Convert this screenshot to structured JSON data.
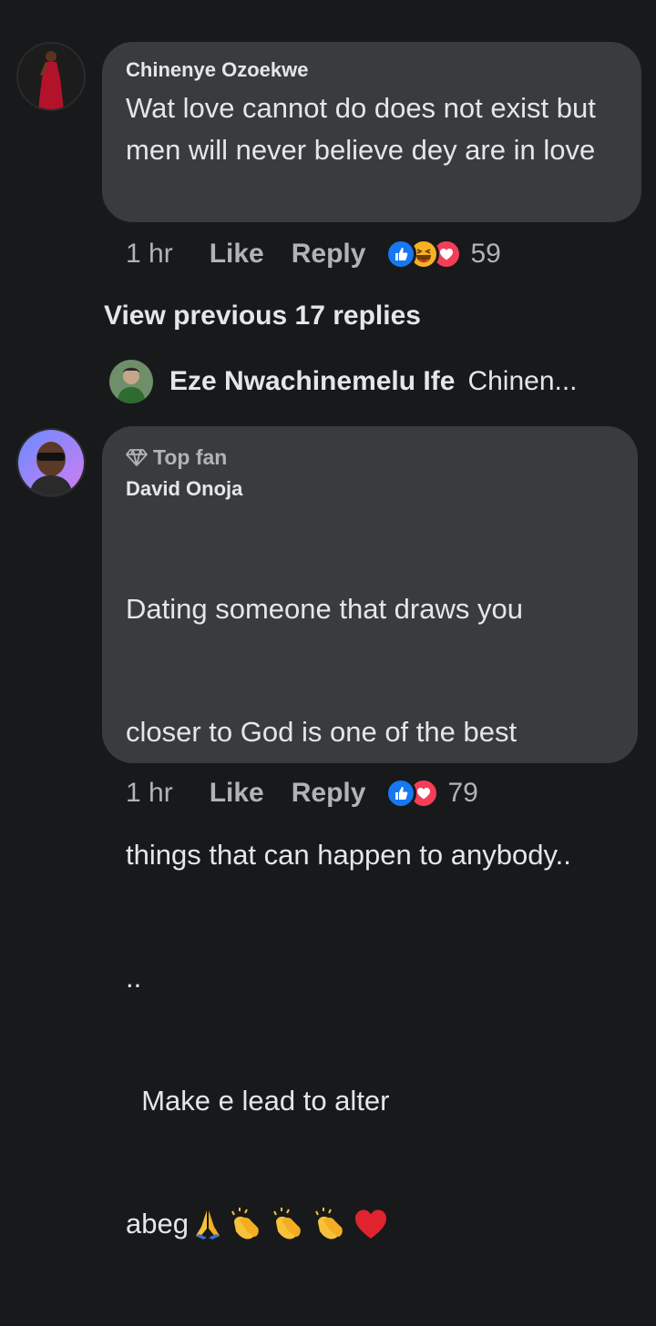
{
  "comments": [
    {
      "author": "Chinenye Ozoekwe",
      "text": "Wat love cannot do does not exist but men will never believe dey are in love",
      "time": "1 hr",
      "like_label": "Like",
      "reply_label": "Reply",
      "reactions": [
        "like",
        "haha",
        "love"
      ],
      "reaction_count": "59"
    },
    {
      "badge": "Top fan",
      "author": "David Onoja",
      "text_lines": [
        "Dating someone that draws you",
        "closer to God is one of the best",
        "things that can happen to anybody..",
        "..",
        "  Make e lead to alter",
        "abeg"
      ],
      "trailing_emojis": [
        "folded-hands",
        "clapping-hands",
        "clapping-hands",
        "clapping-hands",
        "red-heart"
      ],
      "time": "1 hr",
      "like_label": "Like",
      "reply_label": "Reply",
      "reactions": [
        "like",
        "love"
      ],
      "reaction_count": "79"
    }
  ],
  "thread": {
    "view_previous_label": "View previous 17 replies",
    "reply_preview_author": "Eze Nwachinemelu Ife",
    "reply_preview_snippet": "Chinen..."
  },
  "colors": {
    "background": "#18191a",
    "bubble": "#3a3b3c",
    "text_primary": "#e4e6eb",
    "text_secondary": "#b0b3b8",
    "like_blue": "#1877f2",
    "love_red": "#f33e58",
    "haha_yellow": "#f7b125"
  }
}
